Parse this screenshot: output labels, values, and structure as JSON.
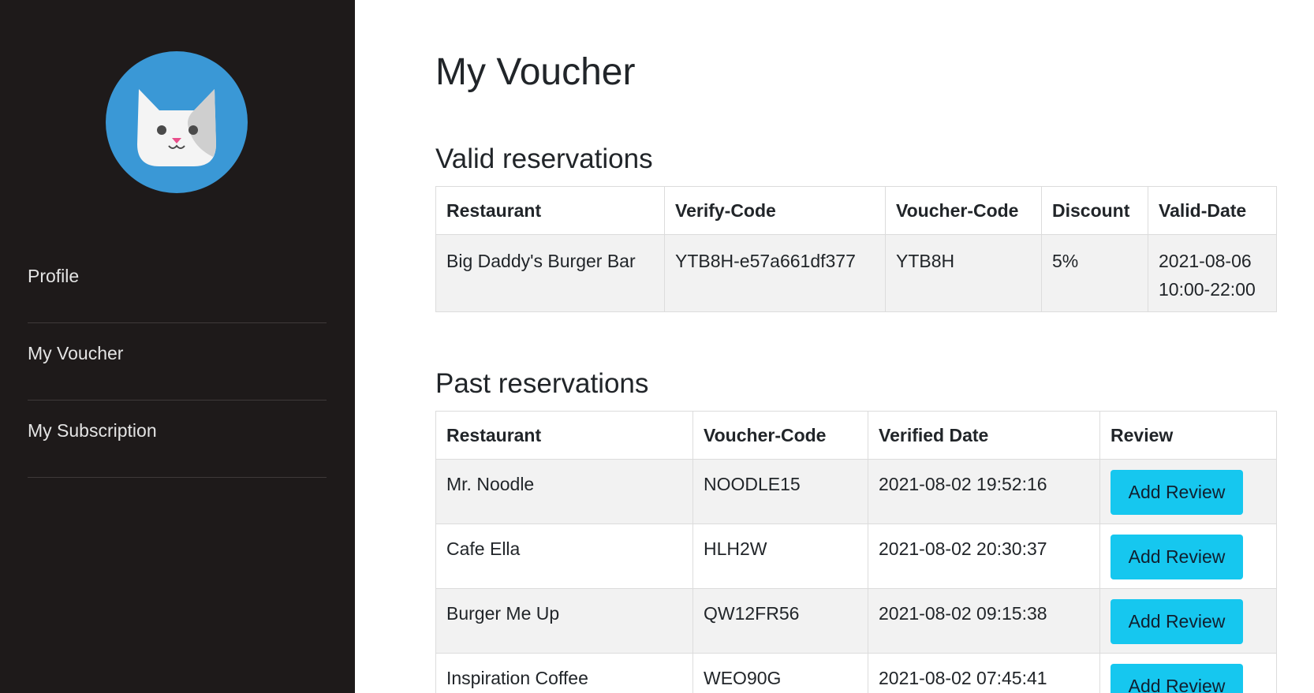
{
  "sidebar": {
    "avatar_icon": "cat-avatar-icon",
    "items": [
      {
        "label": "Profile"
      },
      {
        "label": "My Voucher"
      },
      {
        "label": "My Subscription"
      }
    ]
  },
  "main": {
    "title": "My Voucher",
    "valid": {
      "title": "Valid reservations",
      "headers": [
        "Restaurant",
        "Verify-Code",
        "Voucher-Code",
        "Discount",
        "Valid-Date"
      ],
      "rows": [
        {
          "restaurant": "Big Daddy's Burger Bar",
          "verify_code": "YTB8H-e57a661df377",
          "voucher_code": "YTB8H",
          "discount": "5%",
          "valid_date": "2021-08-06",
          "valid_time": "10:00-22:00"
        }
      ]
    },
    "past": {
      "title": "Past reservations",
      "headers": [
        "Restaurant",
        "Voucher-Code",
        "Verified Date",
        "Review"
      ],
      "rows": [
        {
          "restaurant": "Mr. Noodle",
          "voucher_code": "NOODLE15",
          "verified_date": "2021-08-02 19:52:16",
          "review_label": "Add Review"
        },
        {
          "restaurant": "Cafe Ella",
          "voucher_code": "HLH2W",
          "verified_date": "2021-08-02 20:30:37",
          "review_label": "Add Review"
        },
        {
          "restaurant": "Burger Me Up",
          "voucher_code": "QW12FR56",
          "verified_date": "2021-08-02 09:15:38",
          "review_label": "Add Review"
        },
        {
          "restaurant": "Inspiration Coffee",
          "voucher_code": "WEO90G",
          "verified_date": "2021-08-02 07:45:41",
          "review_label": "Add Review"
        }
      ]
    }
  },
  "colors": {
    "sidebar_bg": "#1e1a1a",
    "avatar_bg": "#3a98d6",
    "button_bg": "#16c7ef",
    "row_alt_bg": "#f2f2f2"
  }
}
